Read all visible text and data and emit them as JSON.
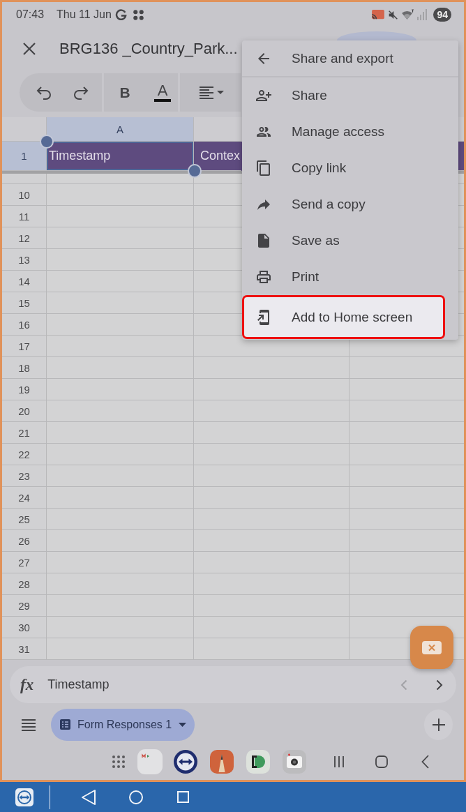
{
  "status_bar": {
    "time": "07:43",
    "date": "Thu 11 Jun",
    "battery": "94"
  },
  "app_bar": {
    "title": "BRG136 _Country_Park..."
  },
  "toolbar": {
    "bold_button": "B",
    "text_color_button": "A"
  },
  "table": {
    "columns": [
      {
        "label": "A",
        "selected": true
      },
      {
        "selected": false
      },
      {
        "selected": false
      }
    ],
    "rows": [
      {
        "kind": "header",
        "number": "1",
        "selected": true,
        "cells": [
          {
            "text": "Timestamp",
            "selected": true
          },
          {
            "text": "Contex",
            "selected": false
          }
        ]
      },
      {
        "kind": "data",
        "number": "10",
        "selected": false
      },
      {
        "kind": "data",
        "number": "11",
        "selected": false
      },
      {
        "kind": "data",
        "number": "12",
        "selected": false
      },
      {
        "kind": "data",
        "number": "13",
        "selected": false
      },
      {
        "kind": "data",
        "number": "14",
        "selected": false
      },
      {
        "kind": "data",
        "number": "15",
        "selected": false
      },
      {
        "kind": "data",
        "number": "16",
        "selected": false
      },
      {
        "kind": "data",
        "number": "17",
        "selected": false
      },
      {
        "kind": "data",
        "number": "18",
        "selected": false
      },
      {
        "kind": "data",
        "number": "19",
        "selected": false
      },
      {
        "kind": "data",
        "number": "20",
        "selected": false
      },
      {
        "kind": "data",
        "number": "21",
        "selected": false
      },
      {
        "kind": "data",
        "number": "22",
        "selected": false
      },
      {
        "kind": "data",
        "number": "23",
        "selected": false
      },
      {
        "kind": "data",
        "number": "24",
        "selected": false
      },
      {
        "kind": "data",
        "number": "25",
        "selected": false
      },
      {
        "kind": "data",
        "number": "26",
        "selected": false
      },
      {
        "kind": "data",
        "number": "27",
        "selected": false
      },
      {
        "kind": "data",
        "number": "28",
        "selected": false
      },
      {
        "kind": "data",
        "number": "29",
        "selected": false
      },
      {
        "kind": "data",
        "number": "30",
        "selected": false
      },
      {
        "kind": "data",
        "number": "31",
        "selected": false
      }
    ]
  },
  "menu": {
    "title": "Share and export",
    "items": [
      {
        "kind": "share",
        "label": "Share",
        "selected": false
      },
      {
        "kind": "access",
        "label": "Manage access",
        "selected": false
      },
      {
        "kind": "link",
        "label": "Copy link",
        "selected": false
      },
      {
        "kind": "send",
        "label": "Send a copy",
        "selected": false
      },
      {
        "kind": "save",
        "label": "Save as",
        "selected": false
      },
      {
        "kind": "print",
        "label": "Print",
        "selected": false
      },
      {
        "kind": "home",
        "label": "Add to Home screen",
        "selected": true
      }
    ]
  },
  "formula_bar": {
    "label": "fx",
    "value": "Timestamp",
    "previous": {
      "disabled": true
    },
    "next": {
      "disabled": false
    }
  },
  "sheet_tabs": [
    {
      "label": "Form Responses 1",
      "selected": true
    }
  ]
}
